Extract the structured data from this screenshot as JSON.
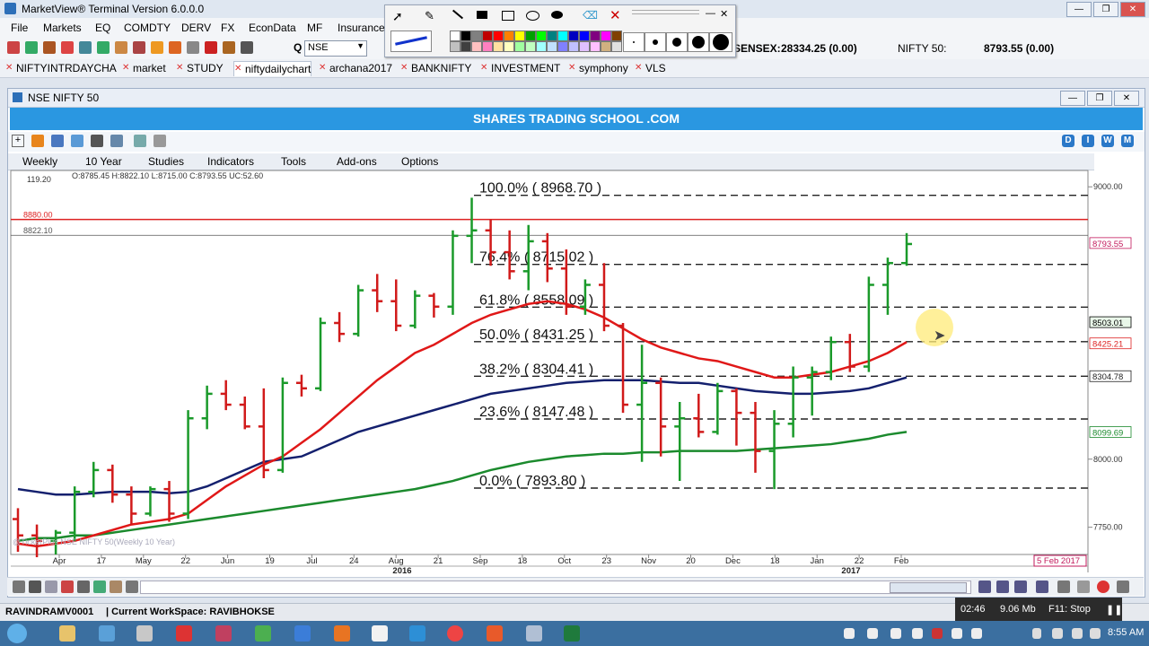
{
  "app": {
    "title": "MarketView®  Terminal Version  6.0.0.0"
  },
  "menu": [
    "File",
    "Markets",
    "EQ",
    "COMDTY",
    "DERV",
    "FX",
    "EconData",
    "MF",
    "Insurance"
  ],
  "toolbar": {
    "search_value": "NSE",
    "q_label": "Q",
    "sensex_label": "SENSEX:",
    "sensex_value": "28334.25 (0.00)",
    "nifty_label": "NIFTY 50:",
    "nifty_value": "8793.55 (0.00)"
  },
  "tabs": [
    "NIFTYINTRDAYCHA",
    "market",
    "STUDY",
    "niftydailychart",
    "archana2017",
    "BANKNIFTY",
    "INVESTMENT",
    "symphony",
    "VLS"
  ],
  "active_tab": "niftydailychart",
  "chart_window": {
    "title": "NSE NIFTY 50",
    "banner": "SHARES TRADING SCHOOL .COM",
    "menu": [
      "Weekly",
      "10 Year",
      "Studies",
      "Indicators",
      "Tools",
      "Add-ons",
      "Options"
    ],
    "right_buttons": [
      "D",
      "I",
      "W",
      "M"
    ],
    "ohlc": "O:8785.45  H:8822.10  L:8715.00  C:8793.55  UC:52.60",
    "watermark": "@TickerPlus  NSE NIFTY 50(Weekly 10 Year)",
    "corner_value": "119.20"
  },
  "chart_data": {
    "type": "ohlc",
    "ylim": [
      7650,
      9060
    ],
    "y_ticks": [
      9000,
      8000,
      7750
    ],
    "y_tick_labels": [
      "9000.00",
      "8000.00",
      "7750.00"
    ],
    "x_labels": [
      "Apr",
      "17",
      "May",
      "22",
      "Jun",
      "19",
      "Jul",
      "24",
      "Aug",
      "21",
      "Sep",
      "18",
      "Oct",
      "23",
      "Nov",
      "20",
      "Dec",
      "18",
      "Jan",
      "22",
      "Feb"
    ],
    "year_labels": [
      "2016",
      "2017"
    ],
    "date_box": "5 Feb 2017",
    "hlines": [
      {
        "value": 8880,
        "label": "8880.00",
        "color": "#d22"
      },
      {
        "value": 8822.1,
        "label": "8822.10",
        "color": "#555"
      }
    ],
    "fibonacci": [
      {
        "label": "100.0% ( 8968.70 )",
        "value": 8968.7
      },
      {
        "label": "76.4% ( 8715.02 )",
        "value": 8715.02
      },
      {
        "label": "61.8% ( 8558.09 )",
        "value": 8558.09
      },
      {
        "label": "50.0% ( 8431.25 )",
        "value": 8431.25
      },
      {
        "label": "38.2% ( 8304.41 )",
        "value": 8304.41
      },
      {
        "label": "23.6% ( 8147.48 )",
        "value": 8147.48
      },
      {
        "label": "0.0% ( 7893.80 )",
        "value": 7893.8
      }
    ],
    "price_tags": [
      {
        "label": "8793.55",
        "value": 8793.55,
        "color": "#c2185b",
        "bg": "#ffffff"
      },
      {
        "label": "8503.01",
        "value": 8503.01,
        "color": "#000",
        "bg": "#e9f7e9"
      },
      {
        "label": "8425.21",
        "value": 8425.21,
        "color": "#d22",
        "bg": "#ffffff"
      },
      {
        "label": "8304.78",
        "value": 8304.78,
        "color": "#222",
        "bg": "#ffffff"
      },
      {
        "label": "8099.69",
        "value": 8099.69,
        "color": "#1b8a2d",
        "bg": "#ffffff"
      }
    ],
    "bars": [
      [
        7780,
        7820,
        7660,
        7720
      ],
      [
        7720,
        7760,
        7640,
        7700
      ],
      [
        7700,
        7740,
        7650,
        7730
      ],
      [
        7730,
        7900,
        7700,
        7880
      ],
      [
        7880,
        7990,
        7860,
        7960
      ],
      [
        7960,
        7980,
        7840,
        7870
      ],
      [
        7870,
        7900,
        7760,
        7800
      ],
      [
        7800,
        7900,
        7790,
        7890
      ],
      [
        7890,
        7920,
        7770,
        7800
      ],
      [
        7800,
        8180,
        7780,
        8150
      ],
      [
        8150,
        8270,
        8110,
        8240
      ],
      [
        8240,
        8290,
        8180,
        8200
      ],
      [
        8200,
        8230,
        8110,
        8120
      ],
      [
        8120,
        8260,
        7930,
        7960
      ],
      [
        7960,
        8300,
        7950,
        8280
      ],
      [
        8280,
        8310,
        8230,
        8260
      ],
      [
        8260,
        8520,
        8250,
        8500
      ],
      [
        8500,
        8540,
        8430,
        8460
      ],
      [
        8460,
        8640,
        8450,
        8620
      ],
      [
        8620,
        8680,
        8540,
        8580
      ],
      [
        8580,
        8660,
        8470,
        8490
      ],
      [
        8490,
        8620,
        8480,
        8600
      ],
      [
        8600,
        8610,
        8520,
        8560
      ],
      [
        8560,
        8840,
        8530,
        8820
      ],
      [
        8820,
        8960,
        8720,
        8840
      ],
      [
        8840,
        8880,
        8710,
        8760
      ],
      [
        8760,
        8840,
        8660,
        8690
      ],
      [
        8690,
        8860,
        8620,
        8800
      ],
      [
        8800,
        8830,
        8650,
        8700
      ],
      [
        8700,
        8770,
        8530,
        8560
      ],
      [
        8560,
        8660,
        8530,
        8640
      ],
      [
        8640,
        8720,
        8470,
        8490
      ],
      [
        8490,
        8500,
        8170,
        8200
      ],
      [
        8200,
        8420,
        7990,
        8280
      ],
      [
        8280,
        8300,
        8010,
        8120
      ],
      [
        8120,
        8210,
        7920,
        8150
      ],
      [
        8150,
        8240,
        8080,
        8100
      ],
      [
        8100,
        8280,
        8090,
        8250
      ],
      [
        8250,
        8260,
        8050,
        8170
      ],
      [
        8170,
        8210,
        7950,
        8030
      ],
      [
        8030,
        8180,
        7890,
        8130
      ],
      [
        8130,
        8340,
        8080,
        8300
      ],
      [
        8300,
        8340,
        8160,
        8320
      ],
      [
        8320,
        8450,
        8290,
        8430
      ],
      [
        8430,
        8460,
        8320,
        8340
      ],
      [
        8340,
        8670,
        8320,
        8640
      ],
      [
        8640,
        8740,
        8530,
        8720
      ],
      [
        8720,
        8830,
        8710,
        8790
      ]
    ],
    "sma_red": [
      7690,
      7680,
      7690,
      7700,
      7720,
      7740,
      7760,
      7770,
      7780,
      7800,
      7850,
      7900,
      7940,
      7980,
      8010,
      8060,
      8110,
      8170,
      8230,
      8290,
      8340,
      8390,
      8420,
      8460,
      8500,
      8530,
      8550,
      8570,
      8580,
      8570,
      8550,
      8520,
      8480,
      8440,
      8410,
      8390,
      8370,
      8360,
      8340,
      8320,
      8300,
      8300,
      8310,
      8320,
      8340,
      8360,
      8390,
      8430
    ],
    "sma_navy": [
      7890,
      7880,
      7870,
      7870,
      7875,
      7880,
      7880,
      7880,
      7875,
      7880,
      7900,
      7930,
      7960,
      7990,
      8000,
      8010,
      8040,
      8070,
      8100,
      8120,
      8140,
      8160,
      8180,
      8200,
      8220,
      8240,
      8250,
      8260,
      8270,
      8280,
      8285,
      8290,
      8290,
      8290,
      8285,
      8280,
      8280,
      8270,
      8260,
      8250,
      8245,
      8240,
      8240,
      8245,
      8250,
      8260,
      8280,
      8300
    ],
    "sma_green": [
      7700,
      7710,
      7710,
      7720,
      7720,
      7730,
      7740,
      7750,
      7760,
      7770,
      7780,
      7790,
      7800,
      7810,
      7820,
      7830,
      7840,
      7850,
      7860,
      7870,
      7880,
      7890,
      7905,
      7920,
      7940,
      7960,
      7975,
      7990,
      8000,
      8010,
      8015,
      8020,
      8020,
      8025,
      8025,
      8030,
      8030,
      8030,
      8030,
      8035,
      8040,
      8045,
      8050,
      8055,
      8065,
      8075,
      8090,
      8100
    ]
  },
  "status": {
    "user": "RAVINDRAMV0001",
    "workspace": "| Current WorkSpace: RAVIBHOKSE"
  },
  "perf": {
    "time": "02:46",
    "size": "9.06 Mb",
    "hint": "F11: Stop"
  },
  "clock": "8:55 AM"
}
